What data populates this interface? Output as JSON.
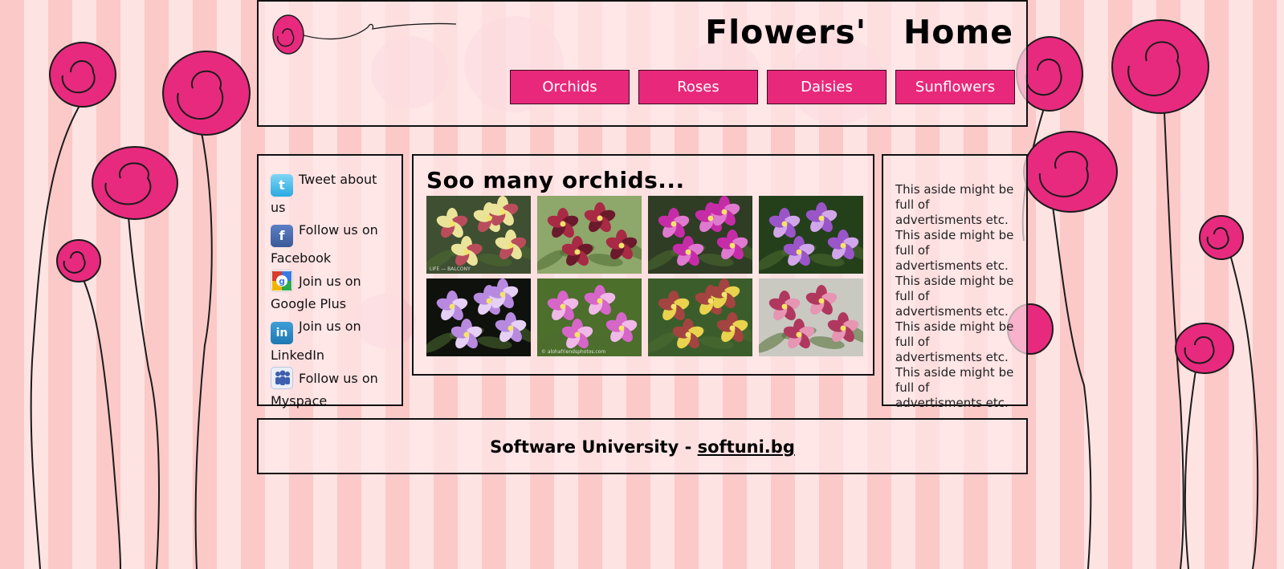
{
  "header": {
    "title": "Flowers'   Home",
    "nav": [
      {
        "label": "Orchids"
      },
      {
        "label": "Roses"
      },
      {
        "label": "Daisies"
      },
      {
        "label": "Sunflowers"
      }
    ]
  },
  "social": [
    {
      "icon": "twitter-icon",
      "label": "Tweet about us"
    },
    {
      "icon": "facebook-icon",
      "label": "Follow us on Facebook"
    },
    {
      "icon": "google-plus-icon",
      "label": "Join us on Google Plus"
    },
    {
      "icon": "linkedin-icon",
      "label": "Join us on LinkedIn"
    },
    {
      "icon": "myspace-icon",
      "label": "Follow us on Myspace"
    }
  ],
  "main": {
    "heading": "Soo many orchids...",
    "photos": [
      {
        "name": "yellow-orchid",
        "colors": [
          "#eae49a",
          "#b94d5c",
          "#3f4f32"
        ],
        "caption": "LIFE — BALCONY"
      },
      {
        "name": "red-orchid",
        "colors": [
          "#a82a44",
          "#6b1a2c",
          "#8ea76b"
        ]
      },
      {
        "name": "magenta-orchid",
        "colors": [
          "#c72ca8",
          "#e07ad0",
          "#2f3d24"
        ]
      },
      {
        "name": "purple-orchid",
        "colors": [
          "#9a55c9",
          "#d2a7ea",
          "#24401b"
        ]
      },
      {
        "name": "lavender-orchid",
        "colors": [
          "#b78ae0",
          "#e6d0f5",
          "#0e110c"
        ]
      },
      {
        "name": "pink-orchid",
        "colors": [
          "#d666c7",
          "#f0b9e8",
          "#4c6f2c"
        ],
        "caption": "© alohafriendsphotos.com"
      },
      {
        "name": "green-red-orchid",
        "colors": [
          "#a34440",
          "#e9d34e",
          "#3b5d2c"
        ]
      },
      {
        "name": "crimson-orchid",
        "colors": [
          "#b0385e",
          "#e695b3",
          "#c9c9c2"
        ]
      }
    ]
  },
  "aside": {
    "text": "This aside might be full of advertisments etc. This aside might be full of advertisments etc. This aside might be full of advertisments etc. This aside might be full of advertisments etc. This aside might be full of advertisments etc."
  },
  "footer": {
    "text": "Software University - ",
    "link": "softuni.bg"
  },
  "colors": {
    "accent": "#e8297b",
    "stripe_dark": "#fbc9c8",
    "stripe_light": "#fde3e2",
    "flower": "#e72a7e"
  }
}
